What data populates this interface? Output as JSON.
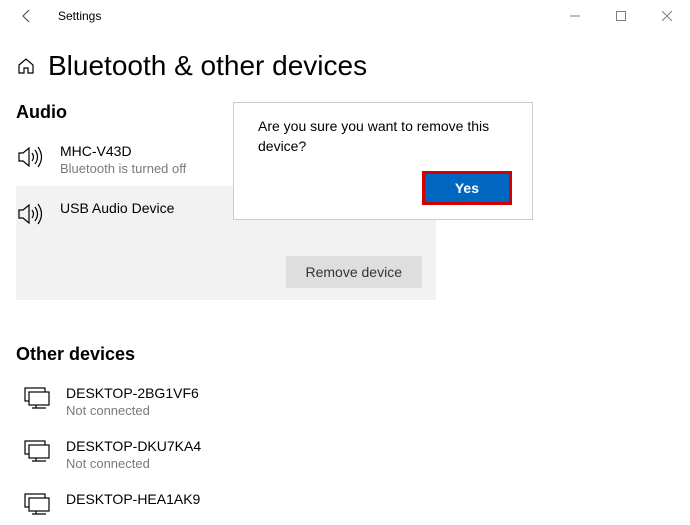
{
  "titlebar": {
    "title": "Settings"
  },
  "header": {
    "title": "Bluetooth & other devices"
  },
  "audio": {
    "section_title": "Audio",
    "devices": [
      {
        "name": "MHC-V43D",
        "status": "Bluetooth is turned off"
      },
      {
        "name": "USB Audio Device"
      }
    ],
    "remove_label": "Remove device"
  },
  "dialog": {
    "text": "Are you sure you want to remove this device?",
    "yes_label": "Yes"
  },
  "other": {
    "section_title": "Other devices",
    "devices": [
      {
        "name": "DESKTOP-2BG1VF6",
        "status": "Not connected"
      },
      {
        "name": "DESKTOP-DKU7KA4",
        "status": "Not connected"
      },
      {
        "name": "DESKTOP-HEA1AK9"
      }
    ]
  }
}
